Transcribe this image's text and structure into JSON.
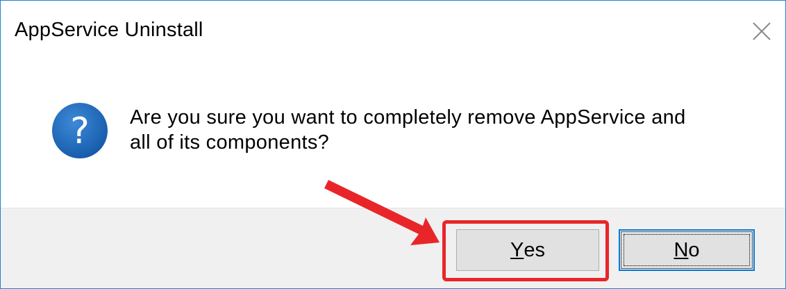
{
  "window": {
    "title": "AppService Uninstall",
    "close_icon": "close-icon"
  },
  "dialog": {
    "icon": "question-icon",
    "message_line1": "Are you sure you want to completely remove AppService and",
    "message_line2": "all of its components?"
  },
  "buttons": {
    "yes": {
      "mnemonic": "Y",
      "rest": "es"
    },
    "no": {
      "mnemonic": "N",
      "rest": "o"
    }
  },
  "annotation": {
    "arrow_color": "#e8262a",
    "highlight_color": "#e8262a",
    "highlighted_button": "yes"
  },
  "colors": {
    "window_border": "#1883d7",
    "icon_blue": "#1f6fbf",
    "button_bar": "#f0f0f0",
    "focus_border": "#0078d7"
  }
}
